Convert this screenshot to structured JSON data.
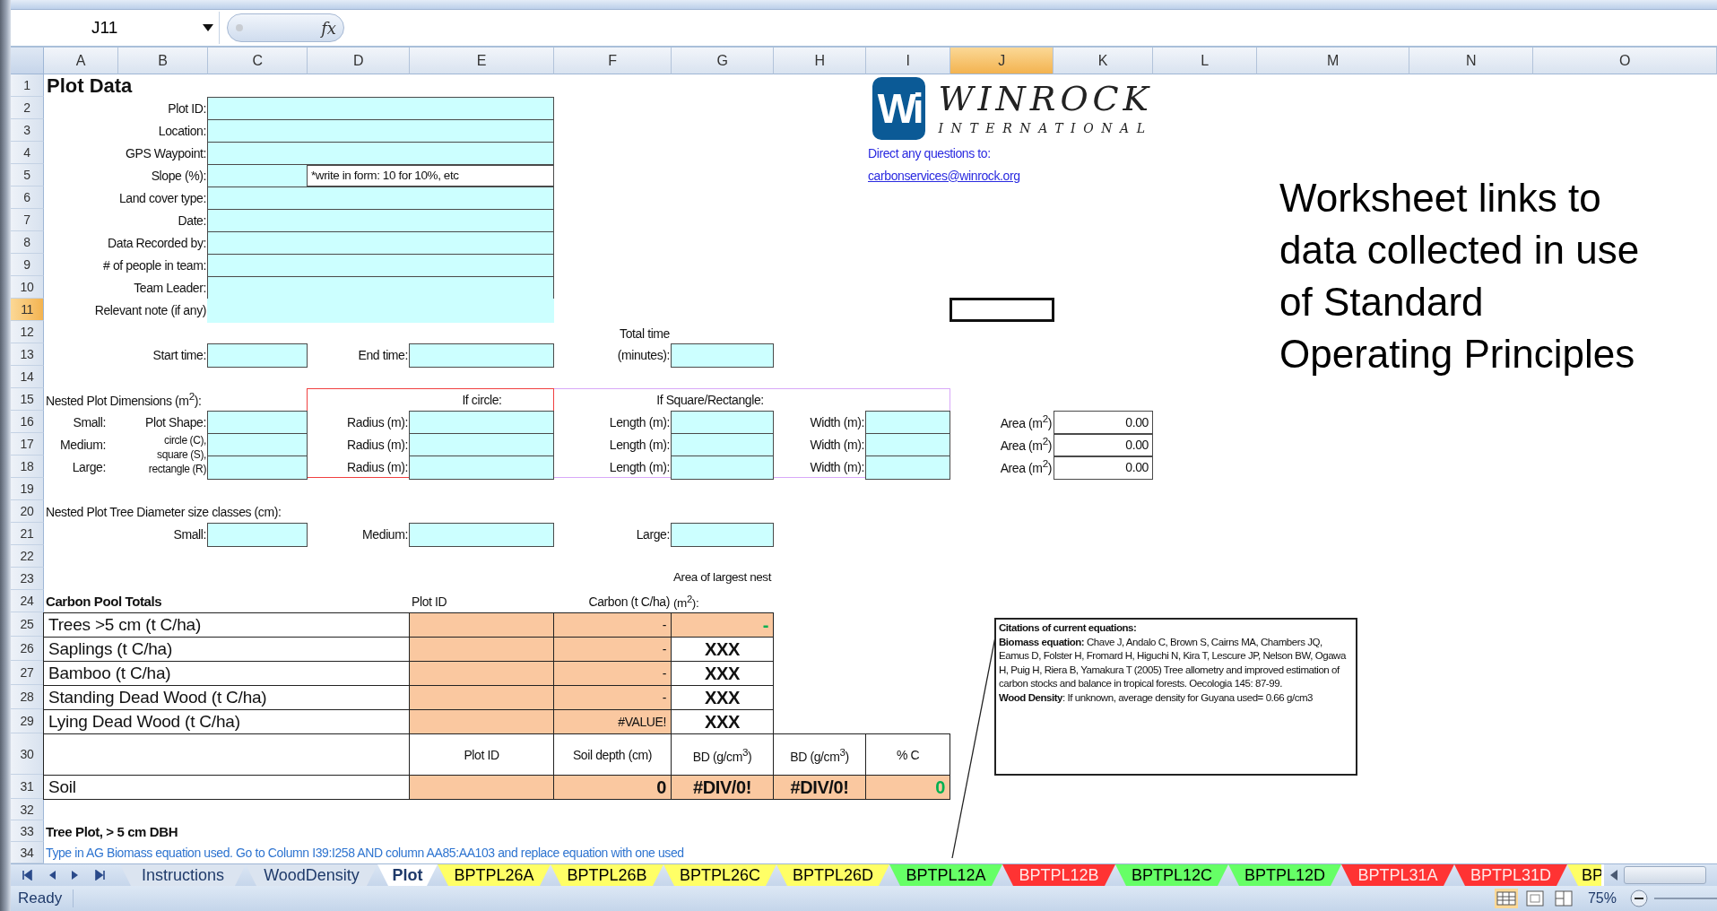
{
  "name_box": "J11",
  "formula_button": "fx",
  "columns": [
    {
      "label": "A",
      "selected": false
    },
    {
      "label": "B",
      "selected": false
    },
    {
      "label": "C",
      "selected": false
    },
    {
      "label": "D",
      "selected": false
    },
    {
      "label": "E",
      "selected": false
    },
    {
      "label": "F",
      "selected": false
    },
    {
      "label": "G",
      "selected": false
    },
    {
      "label": "H",
      "selected": false
    },
    {
      "label": "I",
      "selected": false
    },
    {
      "label": "J",
      "selected": true
    },
    {
      "label": "K",
      "selected": false
    },
    {
      "label": "L",
      "selected": false
    },
    {
      "label": "M",
      "selected": false
    },
    {
      "label": "N",
      "selected": false
    },
    {
      "label": "O",
      "selected": false
    }
  ],
  "rows": [
    {
      "label": "1",
      "selected": false
    },
    {
      "label": "2",
      "selected": false
    },
    {
      "label": "3",
      "selected": false
    },
    {
      "label": "4",
      "selected": false
    },
    {
      "label": "5",
      "selected": false
    },
    {
      "label": "6",
      "selected": false
    },
    {
      "label": "7",
      "selected": false
    },
    {
      "label": "8",
      "selected": false
    },
    {
      "label": "9",
      "selected": false
    },
    {
      "label": "10",
      "selected": false
    },
    {
      "label": "11",
      "selected": true
    },
    {
      "label": "12",
      "selected": false
    },
    {
      "label": "13",
      "selected": false
    },
    {
      "label": "14",
      "selected": false
    },
    {
      "label": "15",
      "selected": false
    },
    {
      "label": "16",
      "selected": false
    },
    {
      "label": "17",
      "selected": false
    },
    {
      "label": "18",
      "selected": false
    },
    {
      "label": "19",
      "selected": false
    },
    {
      "label": "20",
      "selected": false
    },
    {
      "label": "21",
      "selected": false
    },
    {
      "label": "22",
      "selected": false
    },
    {
      "label": "23",
      "selected": false
    },
    {
      "label": "24",
      "selected": false
    },
    {
      "label": "25",
      "selected": false
    },
    {
      "label": "26",
      "selected": false
    },
    {
      "label": "27",
      "selected": false
    },
    {
      "label": "28",
      "selected": false
    },
    {
      "label": "29",
      "selected": false
    },
    {
      "label": "30",
      "selected": false
    },
    {
      "label": "31",
      "selected": false
    },
    {
      "label": "32",
      "selected": false
    },
    {
      "label": "33",
      "selected": false
    },
    {
      "label": "34",
      "selected": false
    }
  ],
  "sheet": {
    "title": "Plot Data",
    "plot_fields": [
      {
        "label": "Plot ID:",
        "kind": "wide"
      },
      {
        "label": "Location:",
        "kind": "wide"
      },
      {
        "label": "GPS Waypoint:",
        "kind": "wide"
      },
      {
        "label": "Slope (%):",
        "kind": "short",
        "note": "*write in form: 10 for 10%, etc"
      },
      {
        "label": "Land cover type:",
        "kind": "wide"
      },
      {
        "label": "Date:",
        "kind": "wide"
      },
      {
        "label": "Data Recorded by:",
        "kind": "wide"
      },
      {
        "label": "# of people in team:",
        "kind": "wide"
      },
      {
        "label": "Team Leader:",
        "kind": "wide"
      },
      {
        "label": "Relevant note (if any)",
        "kind": "borderless"
      }
    ],
    "times": [
      "Start time:",
      "End time:",
      "Total time (minutes):"
    ],
    "nested": {
      "title": "Nested Plot Dimensions (m$^{2}$):",
      "shape_label": "Plot Shape:",
      "shape_hint": "circle (C), square (S), rectangle (R)",
      "circle_heading": "If circle:",
      "square_heading": "If Square/Rectangle:",
      "sizes": [
        {
          "name": "Small:",
          "radius_label": "Radius (m):",
          "length_label": "Length (m):",
          "width_label": "Width (m):",
          "area_label": "Area (m$^{2}$)",
          "area": "0.00"
        },
        {
          "name": "Medium:",
          "radius_label": "Radius (m):",
          "length_label": "Length (m):",
          "width_label": "Width (m):",
          "area_label": "Area (m$^{2}$)",
          "area": "0.00"
        },
        {
          "name": "Large:",
          "radius_label": "Radius (m):",
          "length_label": "Length (m):",
          "width_label": "Width (m):",
          "area_label": "Area (m$^{2}$)",
          "area": "0.00"
        }
      ]
    },
    "diameter": {
      "title": "Nested Plot Tree Diameter size classes (cm):",
      "classes": [
        "Small:",
        "Medium:",
        "Large:"
      ]
    },
    "carbon": {
      "title": "Carbon Pool Totals",
      "headers": [
        "Plot ID",
        "Carbon (t C/ha)",
        "Area of largest nest (m$^{2}$):"
      ],
      "rows": [
        {
          "name": "Trees >5 cm (t C/ha)",
          "carbon": "-",
          "area": {
            "text": "-",
            "kind": "computed",
            "color": "#00b050"
          }
        },
        {
          "name": "Saplings (t C/ha)",
          "carbon": "-",
          "area": {
            "text": "XXX",
            "kind": "fixed"
          }
        },
        {
          "name": "Bamboo (t C/ha)",
          "carbon": "-",
          "area": {
            "text": "XXX",
            "kind": "fixed"
          }
        },
        {
          "name": "Standing Dead Wood (t C/ha)",
          "carbon": "-",
          "area": {
            "text": "XXX",
            "kind": "fixed"
          }
        },
        {
          "name": "Lying Dead Wood (t C/ha)",
          "carbon": "#VALUE!",
          "area": {
            "text": "XXX",
            "kind": "fixed"
          }
        }
      ]
    },
    "soil": {
      "name": "Soil",
      "headers": [
        "Plot ID",
        "Soil depth (cm)",
        "BD (g/cm$^{3}$)",
        "BD (g/cm$^{3}$)",
        "% C"
      ],
      "values": [
        {
          "text": "0"
        },
        {
          "text": "#DIV/0!"
        },
        {
          "text": "#DIV/0!"
        },
        {
          "text": "0",
          "color": "#00b050"
        }
      ]
    },
    "tree_plot": "Tree Plot, > 5 cm DBH",
    "instruction": "Type in AG Biomass equation used. Go to Column I39:I258 AND column AA85:AA103 and replace equation with one used"
  },
  "logo": {
    "mark": "Wi",
    "name": "WINROCK",
    "subtitle": "INTERNATIONAL"
  },
  "contact": {
    "text": "Direct any questions to:",
    "email": "carbonservices@winrock.org"
  },
  "citations": {
    "title": "Citations of current equations:",
    "paragraphs": [
      "**Biomass equation:** Chave J, Andalo C, Brown S, Cairns MA, Chambers JQ, Eamus D, Folster H, Fromard H, Higuchi N, Kira T, Lescure JP, Nelson BW, Ogawa H, Puig H, Riera B, Yamakura T (2005) Tree allometry and improved estimation of carbon stocks and balance in tropical forests. Oecologia 145: 87-99.",
      "**Wood Density**: If unknown, average density for Guyana used= 0.66 g/cm3"
    ]
  },
  "side_note": "Worksheet links to data collected in use of Standard Operating Principles",
  "tabs": [
    {
      "label": "Instructions",
      "selected": false
    },
    {
      "label": "WoodDensity",
      "selected": false
    },
    {
      "label": "Plot",
      "selected": true
    },
    {
      "label": "BPTPL26A",
      "selected": false,
      "color": "#ffff66"
    },
    {
      "label": "BPTPL26B",
      "selected": false,
      "color": "#ffff66"
    },
    {
      "label": "BPTPL26C",
      "selected": false,
      "color": "#ffff66"
    },
    {
      "label": "BPTPL26D",
      "selected": false,
      "color": "#ffff66"
    },
    {
      "label": "BPTPL12A",
      "selected": false,
      "color": "#66ff66"
    },
    {
      "label": "BPTPL12B",
      "selected": false,
      "color": "#ff3333"
    },
    {
      "label": "BPTPL12C",
      "selected": false,
      "color": "#66ff66"
    },
    {
      "label": "BPTPL12D",
      "selected": false,
      "color": "#66ff66"
    },
    {
      "label": "BPTPL31A",
      "selected": false,
      "color": "#ff3333"
    },
    {
      "label": "BPTPL31D",
      "selected": false,
      "color": "#ff3333"
    },
    {
      "label": "BP",
      "selected": false,
      "color": "#ffff66"
    }
  ],
  "status": {
    "text": "Ready",
    "zoom": "75%"
  }
}
